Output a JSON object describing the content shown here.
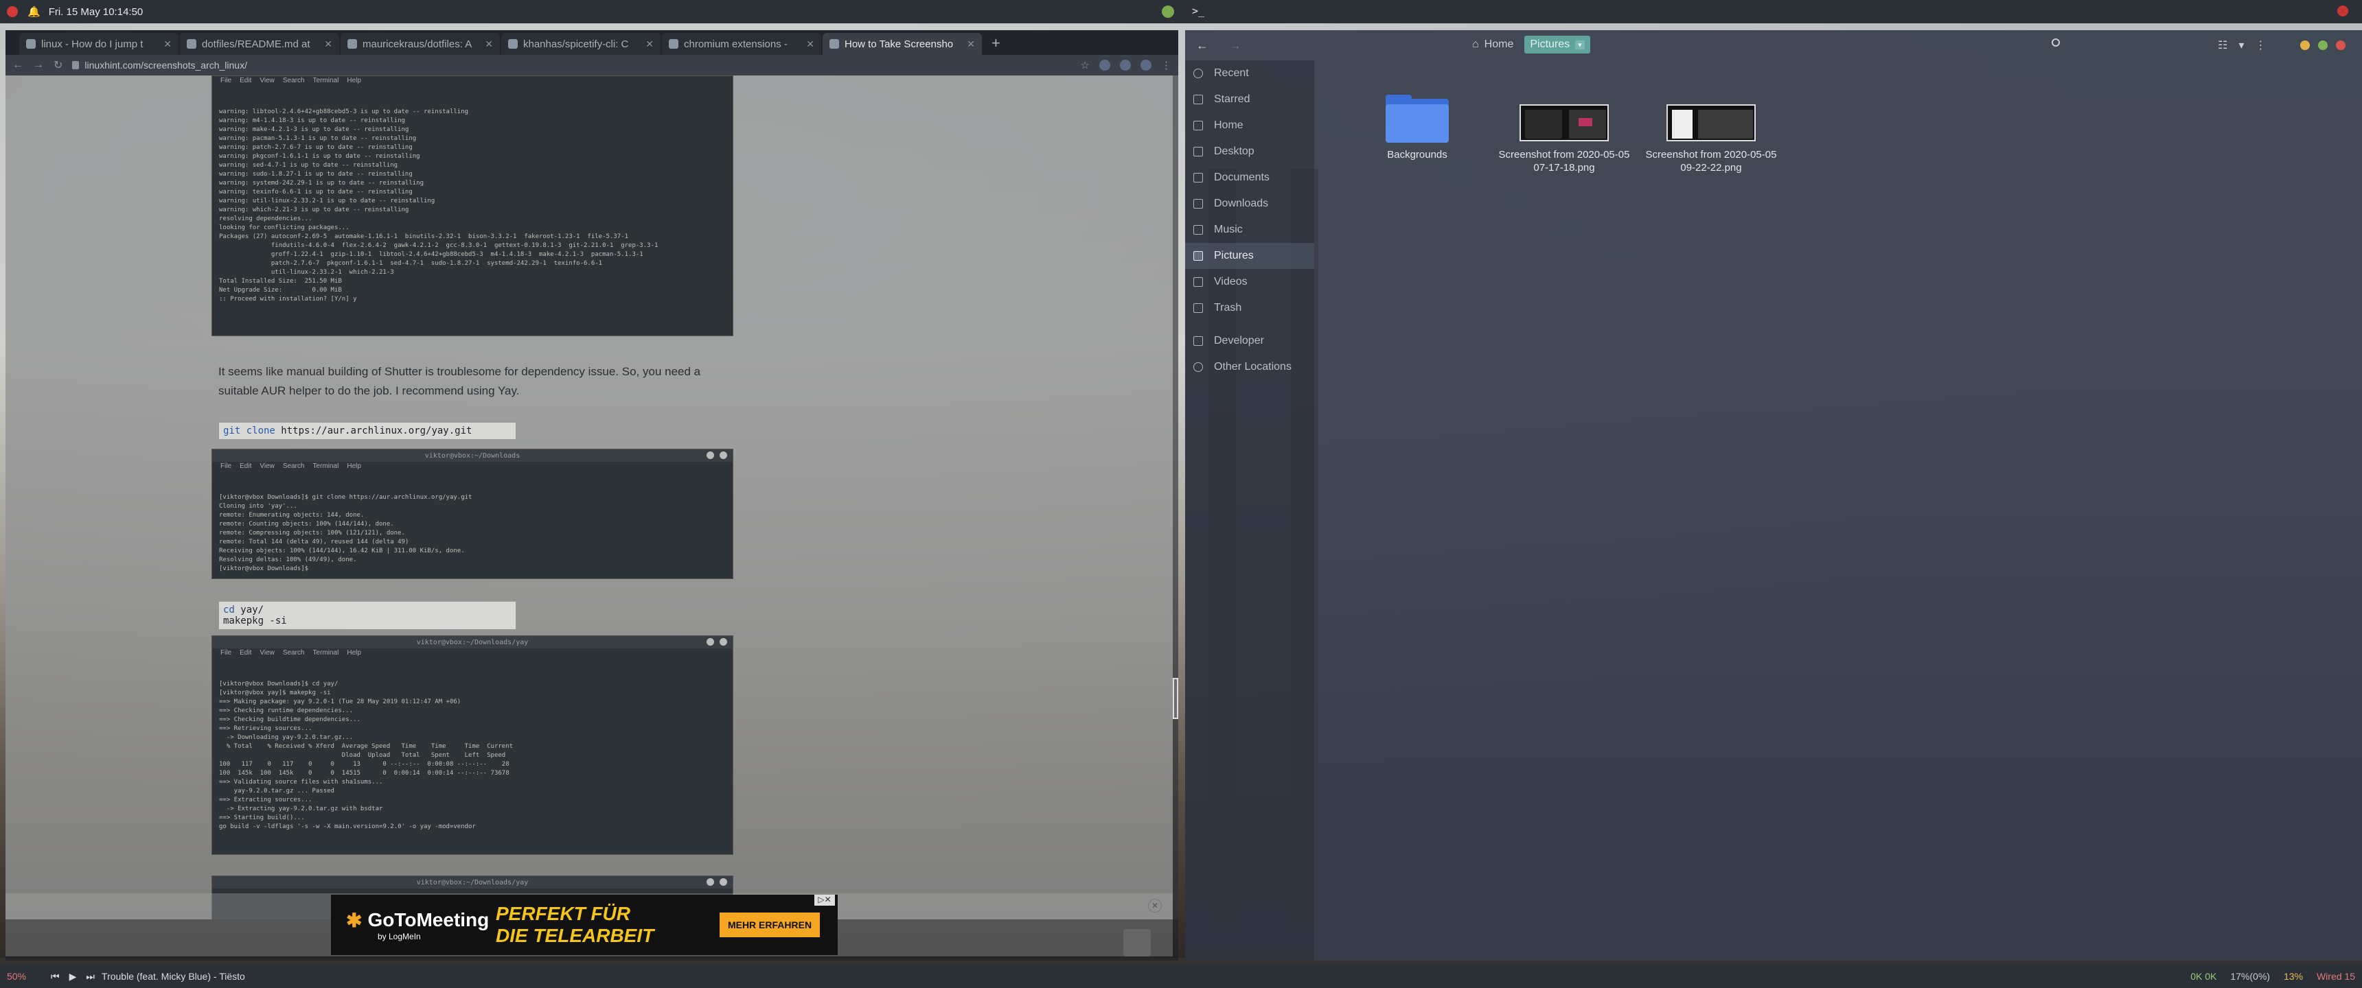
{
  "topbar": {
    "clock": "Fri. 15 May 10:14:50",
    "terminal_glyph": ">_"
  },
  "browser": {
    "tabs": [
      {
        "label": "linux - How do I jump t"
      },
      {
        "label": "dotfiles/README.md at"
      },
      {
        "label": "mauricekraus/dotfiles: A"
      },
      {
        "label": "khanhas/spicetify-cli: C"
      },
      {
        "label": "chromium extensions -"
      },
      {
        "label": "How to Take Screensho"
      }
    ],
    "new_tab": "+",
    "url": "linuxhint.com/screenshots_arch_linux/"
  },
  "article": {
    "term1": {
      "menu": [
        "File",
        "Edit",
        "View",
        "Search",
        "Terminal",
        "Help"
      ],
      "lines": [
        "warning: libtool-2.4.6+42+gb88cebd5-3 is up to date -- reinstalling",
        "warning: m4-1.4.18-3 is up to date -- reinstalling",
        "warning: make-4.2.1-3 is up to date -- reinstalling",
        "warning: pacman-5.1.3-1 is up to date -- reinstalling",
        "warning: patch-2.7.6-7 is up to date -- reinstalling",
        "warning: pkgconf-1.6.1-1 is up to date -- reinstalling",
        "warning: sed-4.7-1 is up to date -- reinstalling",
        "warning: sudo-1.8.27-1 is up to date -- reinstalling",
        "warning: systemd-242.29-1 is up to date -- reinstalling",
        "warning: texinfo-6.6-1 is up to date -- reinstalling",
        "warning: util-linux-2.33.2-1 is up to date -- reinstalling",
        "warning: which-2.21-3 is up to date -- reinstalling",
        "resolving dependencies...",
        "looking for conflicting packages...",
        "",
        "Packages (27) autoconf-2.69-5  automake-1.16.1-1  binutils-2.32-1  bison-3.3.2-1  fakeroot-1.23-1  file-5.37-1",
        "              findutils-4.6.0-4  flex-2.6.4-2  gawk-4.2.1-2  gcc-8.3.0-1  gettext-0.19.8.1-3  git-2.21.0-1  grep-3.3-1",
        "              groff-1.22.4-1  gzip-1.10-1  libtool-2.4.6+42+gb88cebd5-3  m4-1.4.18-3  make-4.2.1-3  pacman-5.1.3-1",
        "              patch-2.7.6-7  pkgconf-1.6.1-1  sed-4.7-1  sudo-1.8.27-1  systemd-242.29-1  texinfo-6.6-1",
        "              util-linux-2.33.2-1  which-2.21-3",
        "",
        "Total Installed Size:  251.50 MiB",
        "Net Upgrade Size:        0.00 MiB",
        "",
        ":: Proceed with installation? [Y/n] y"
      ]
    },
    "paragraph": "It seems like manual building of Shutter is troublesome for dependency issue. So, you need a suitable AUR helper to do the job. I recommend using Yay.",
    "code1": {
      "cmd": "git clone",
      "arg": "https://aur.archlinux.org/yay.git"
    },
    "term2": {
      "title": "viktor@vbox:~/Downloads",
      "menu": [
        "File",
        "Edit",
        "View",
        "Search",
        "Terminal",
        "Help"
      ],
      "lines": [
        "[viktor@vbox Downloads]$ git clone https://aur.archlinux.org/yay.git",
        "Cloning into 'yay'...",
        "remote: Enumerating objects: 144, done.",
        "remote: Counting objects: 100% (144/144), done.",
        "remote: Compressing objects: 100% (121/121), done.",
        "remote: Total 144 (delta 49), reused 144 (delta 49)",
        "Receiving objects: 100% (144/144), 16.42 KiB | 311.00 KiB/s, done.",
        "Resolving deltas: 100% (49/49), done.",
        "[viktor@vbox Downloads]$ "
      ]
    },
    "code2": {
      "cmd": "cd",
      "arg": "yay/",
      "line2": "makepkg -si"
    },
    "term3": {
      "title": "viktor@vbox:~/Downloads/yay",
      "menu": [
        "File",
        "Edit",
        "View",
        "Search",
        "Terminal",
        "Help"
      ],
      "lines": [
        "[viktor@vbox Downloads]$ cd yay/",
        "[viktor@vbox yay]$ makepkg -si",
        "==> Making package: yay 9.2.0-1 (Tue 28 May 2019 01:12:47 AM +06)",
        "==> Checking runtime dependencies...",
        "==> Checking buildtime dependencies...",
        "==> Retrieving sources...",
        "  -> Downloading yay-9.2.0.tar.gz...",
        "  % Total    % Received % Xferd  Average Speed   Time    Time     Time  Current",
        "                                 Dload  Upload   Total   Spent    Left  Speed",
        "100   117    0   117    0     0     13      0 --:--:--  0:00:08 --:--:--    28",
        "100  145k  100  145k    0     0  14515      0  0:00:14  0:00:14 --:--:-- 73678",
        "==> Validating source files with sha1sums...",
        "    yay-9.2.0.tar.gz ... Passed",
        "==> Extracting sources...",
        "  -> Extracting yay-9.2.0.tar.gz with bsdtar",
        "==> Starting build()...",
        "go build -v -ldflags '-s -w -X main.version=9.2.0' -o yay -mod=vendor"
      ]
    },
    "term4_title": "viktor@vbox:~/Downloads/yay"
  },
  "ad": {
    "brand": "GoToMeeting",
    "byline": "by LogMeIn",
    "slogan_line1": "PERFEKT FÜR",
    "slogan_line2": "DIE TELEARBEIT",
    "cta": "MEHR ERFAHREN",
    "close": "✕"
  },
  "files": {
    "breadcrumb": {
      "home": "Home",
      "current": "Pictures"
    },
    "sidebar": [
      {
        "label": "Recent",
        "icon": "clock-icon"
      },
      {
        "label": "Starred",
        "icon": "star-icon"
      },
      {
        "label": "Home",
        "icon": "home-icon"
      },
      {
        "label": "Desktop",
        "icon": "desktop-icon"
      },
      {
        "label": "Documents",
        "icon": "document-icon"
      },
      {
        "label": "Downloads",
        "icon": "download-icon"
      },
      {
        "label": "Music",
        "icon": "music-icon"
      },
      {
        "label": "Pictures",
        "icon": "picture-icon",
        "active": true
      },
      {
        "label": "Videos",
        "icon": "video-icon"
      },
      {
        "label": "Trash",
        "icon": "trash-icon"
      },
      {
        "label": "Developer",
        "icon": "folder-icon"
      },
      {
        "label": "Other Locations",
        "icon": "plus-icon"
      }
    ],
    "items": [
      {
        "name": "Backgrounds",
        "kind": "folder"
      },
      {
        "name": "Screenshot from 2020-05-05 07-17-18.png",
        "kind": "image"
      },
      {
        "name": "Screenshot from 2020-05-05 09-22-22.png",
        "kind": "image"
      }
    ],
    "window_controls": {
      "colors": [
        "#e4b04a",
        "#7db35a",
        "#d9534f"
      ]
    }
  },
  "statusbar": {
    "volume": "50%",
    "song": "Trouble (feat. Micky Blue) - Tiësto",
    "net": "0K  0K",
    "cpu": "17%(0%)",
    "battery": "13%",
    "wifi": "Wired 15"
  }
}
